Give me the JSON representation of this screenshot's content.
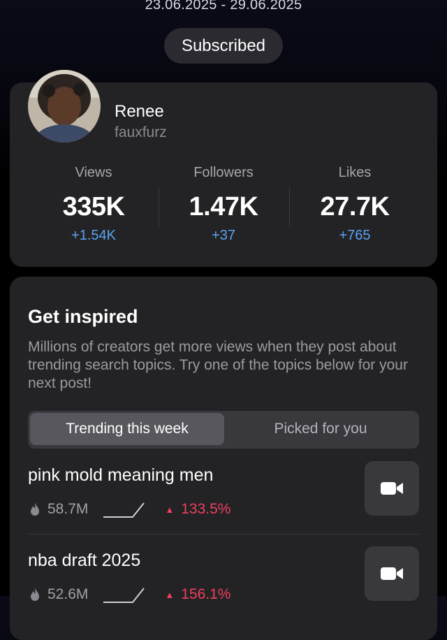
{
  "header": {
    "date_range": "23.06.2025 - 29.06.2025",
    "subscribe_label": "Subscribed"
  },
  "profile": {
    "name": "Renee",
    "handle": "fauxfurz",
    "stats": [
      {
        "label": "Views",
        "value": "335K",
        "delta": "+1.54K"
      },
      {
        "label": "Followers",
        "value": "1.47K",
        "delta": "+37"
      },
      {
        "label": "Likes",
        "value": "27.7K",
        "delta": "+765"
      }
    ]
  },
  "inspire": {
    "title": "Get inspired",
    "description": "Millions of creators get more views when they post about trending search topics. Try one of the topics below for your next post!",
    "tabs": [
      {
        "label": "Trending this week",
        "active": true
      },
      {
        "label": "Picked for you",
        "active": false
      }
    ],
    "topics": [
      {
        "title": "pink mold meaning men",
        "count": "58.7M",
        "change": "133.5%"
      },
      {
        "title": "nba draft 2025",
        "count": "52.6M",
        "change": "156.1%"
      }
    ]
  },
  "colors": {
    "accent_blue": "#5aa2f0",
    "trend_red": "#ef3f5c",
    "card_bg": "#232326"
  },
  "icons": {
    "flame": "flame-icon",
    "camera": "video-camera-icon",
    "sparkline": "trend-sparkline-icon",
    "up": "triangle-up-icon"
  }
}
